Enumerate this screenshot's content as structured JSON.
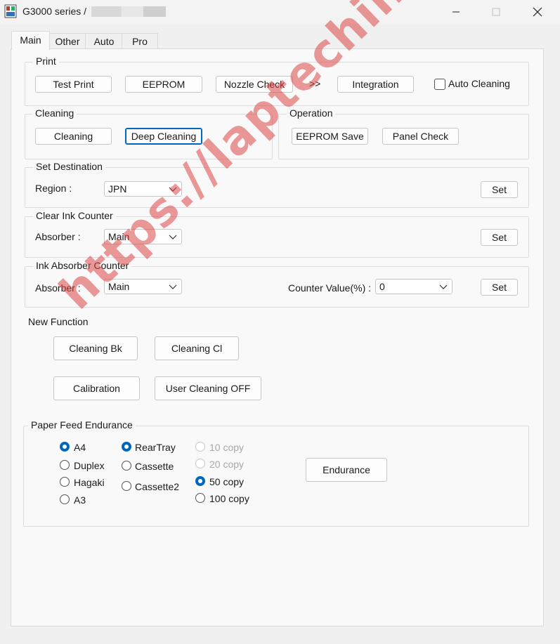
{
  "window": {
    "title": "G3000 series /",
    "controls": {
      "minimize_icon": "minimize-icon",
      "maximize_icon": "maximize-icon",
      "close_icon": "close-icon"
    }
  },
  "tabs": [
    {
      "label": "Main",
      "active": true
    },
    {
      "label": "Other",
      "active": false
    },
    {
      "label": "Auto",
      "active": false
    },
    {
      "label": "Pro",
      "active": false
    }
  ],
  "print_group": {
    "legend": "Print",
    "test_print": "Test Print",
    "eeprom": "EEPROM",
    "nozzle_check": "Nozzle Check",
    "arrow": ">>",
    "integration": "Integration",
    "auto_cleaning": {
      "label": "Auto Cleaning",
      "checked": false
    }
  },
  "cleaning_group": {
    "legend": "Cleaning",
    "cleaning": "Cleaning",
    "deep_cleaning": "Deep Cleaning"
  },
  "operation_group": {
    "legend": "Operation",
    "eeprom_save": "EEPROM Save",
    "panel_check": "Panel Check"
  },
  "destination_group": {
    "legend": "Set Destination",
    "region_label": "Region :",
    "region_value": "JPN",
    "set": "Set"
  },
  "clear_ink_group": {
    "legend": "Clear Ink Counter",
    "absorber_label": "Absorber :",
    "absorber_value": "Main",
    "set": "Set"
  },
  "ink_absorber_group": {
    "legend": "Ink Absorber Counter",
    "absorber_label": "Absorber :",
    "absorber_value": "Main",
    "counter_label": "Counter Value(%) :",
    "counter_value": "0",
    "set": "Set"
  },
  "new_function": {
    "title": "New Function",
    "cleaning_bk": "Cleaning Bk",
    "cleaning_cl": "Cleaning Cl",
    "calibration": "Calibration",
    "user_cleaning_off": "User Cleaning OFF"
  },
  "paper_feed": {
    "legend": "Paper Feed Endurance",
    "paper_sizes": [
      {
        "label": "A4",
        "checked": true
      },
      {
        "label": "Duplex",
        "checked": false
      },
      {
        "label": "Hagaki",
        "checked": false
      },
      {
        "label": "A3",
        "checked": false
      }
    ],
    "sources": [
      {
        "label": "RearTray",
        "checked": true
      },
      {
        "label": "Cassette",
        "checked": false
      },
      {
        "label": "Cassette2",
        "checked": false
      }
    ],
    "copies": [
      {
        "label": "10 copy",
        "checked": false,
        "disabled": true
      },
      {
        "label": "20 copy",
        "checked": false,
        "disabled": true
      },
      {
        "label": "50 copy",
        "checked": true,
        "disabled": false
      },
      {
        "label": "100 copy",
        "checked": false,
        "disabled": false
      }
    ],
    "endurance": "Endurance"
  },
  "watermark": "https://laptechinfo.com",
  "colors": {
    "accent": "#0067c0",
    "watermark": "#dc4646",
    "background": "#f0f0f0",
    "panel": "#f9f9f9"
  }
}
